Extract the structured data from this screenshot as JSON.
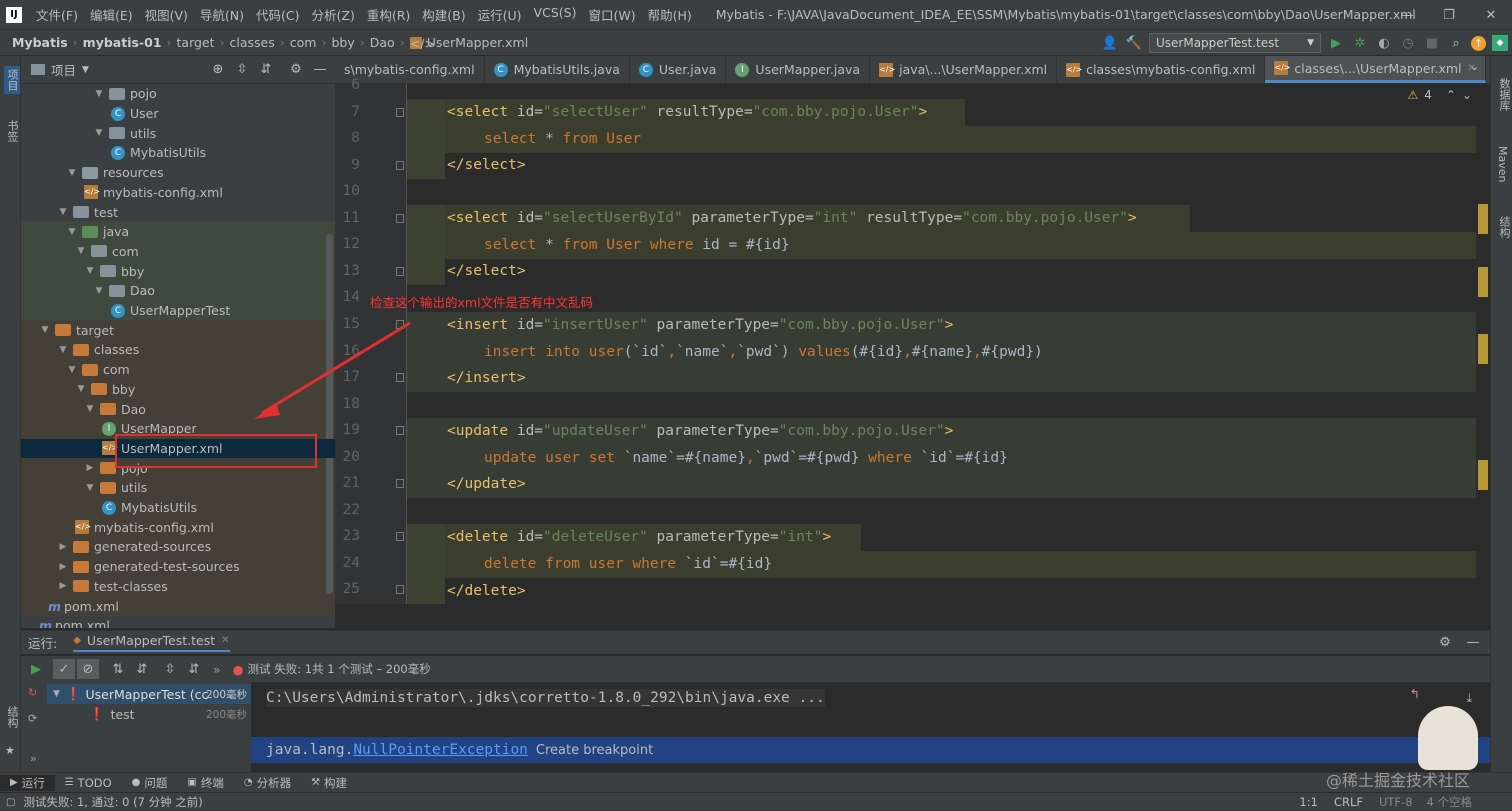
{
  "menu": [
    "文件(F)",
    "编辑(E)",
    "视图(V)",
    "导航(N)",
    "代码(C)",
    "分析(Z)",
    "重构(R)",
    "构建(B)",
    "运行(U)",
    "VCS(S)",
    "窗口(W)",
    "帮助(H)"
  ],
  "window_title": "Mybatis - F:\\JAVA\\JavaDocument_IDEA_EE\\SSM\\Mybatis\\mybatis-01\\target\\classes\\com\\bby\\Dao\\UserMapper.xml",
  "breadcrumb": [
    "Mybatis",
    "mybatis-01",
    "target",
    "classes",
    "com",
    "bby",
    "Dao",
    "UserMapper.xml"
  ],
  "run_config": "UserMapperTest.test",
  "left_stripe": {
    "project": "项目",
    "bookmarks": "书签",
    "structure": "结构"
  },
  "right_stripe": {
    "database": "数据库",
    "maven": "Maven",
    "structure": "结构"
  },
  "project_panel_title": "项目",
  "tree": [
    {
      "depth": 8,
      "kind": "folder",
      "expanded": true,
      "label": "pojo"
    },
    {
      "depth": 10,
      "kind": "class",
      "label": "User"
    },
    {
      "depth": 8,
      "kind": "folder",
      "expanded": true,
      "label": "utils"
    },
    {
      "depth": 10,
      "kind": "class",
      "label": "MybatisUtils"
    },
    {
      "depth": 5,
      "kind": "res",
      "expanded": true,
      "label": "resources"
    },
    {
      "depth": 7,
      "kind": "xml",
      "label": "mybatis-config.xml"
    },
    {
      "depth": 4,
      "kind": "folder",
      "expanded": true,
      "label": "test"
    },
    {
      "depth": 5,
      "kind": "src",
      "expanded": true,
      "label": "java"
    },
    {
      "depth": 6,
      "kind": "folder",
      "expanded": true,
      "label": "com"
    },
    {
      "depth": 7,
      "kind": "folder",
      "expanded": true,
      "label": "bby"
    },
    {
      "depth": 8,
      "kind": "folder",
      "expanded": true,
      "label": "Dao"
    },
    {
      "depth": 10,
      "kind": "class",
      "label": "UserMapperTest"
    },
    {
      "depth": 2,
      "kind": "ofolder",
      "expanded": true,
      "label": "target"
    },
    {
      "depth": 4,
      "kind": "ofolder",
      "expanded": true,
      "label": "classes"
    },
    {
      "depth": 5,
      "kind": "ofolder",
      "expanded": true,
      "label": "com"
    },
    {
      "depth": 6,
      "kind": "ofolder",
      "expanded": true,
      "label": "bby"
    },
    {
      "depth": 7,
      "kind": "ofolder",
      "expanded": true,
      "label": "Dao"
    },
    {
      "depth": 9,
      "kind": "intf",
      "label": "UserMapper"
    },
    {
      "depth": 9,
      "kind": "xml",
      "label": "UserMapper.xml",
      "selected": true
    },
    {
      "depth": 7,
      "kind": "ofolder",
      "expanded": false,
      "label": "pojo"
    },
    {
      "depth": 7,
      "kind": "ofolder",
      "expanded": true,
      "label": "utils"
    },
    {
      "depth": 9,
      "kind": "class",
      "label": "MybatisUtils"
    },
    {
      "depth": 6,
      "kind": "xml",
      "label": "mybatis-config.xml"
    },
    {
      "depth": 4,
      "kind": "ofolder",
      "expanded": false,
      "label": "generated-sources"
    },
    {
      "depth": 4,
      "kind": "ofolder",
      "expanded": false,
      "label": "generated-test-sources"
    },
    {
      "depth": 4,
      "kind": "ofolder",
      "expanded": false,
      "label": "test-classes"
    },
    {
      "depth": 3,
      "kind": "mvn",
      "label": "pom.xml"
    },
    {
      "depth": 2,
      "kind": "mvn",
      "label": "pom.xml"
    }
  ],
  "tabs": [
    {
      "label": "s\\mybatis-config.xml",
      "icon": "xml"
    },
    {
      "label": "MybatisUtils.java",
      "icon": "class"
    },
    {
      "label": "User.java",
      "icon": "class"
    },
    {
      "label": "UserMapper.java",
      "icon": "intf"
    },
    {
      "label": "java\\...\\UserMapper.xml",
      "icon": "xml"
    },
    {
      "label": "classes\\mybatis-config.xml",
      "icon": "xml"
    },
    {
      "label": "classes\\...\\UserMapper.xml",
      "icon": "xml",
      "active": true
    }
  ],
  "warnings_count": "4",
  "line_numbers": [
    "6",
    "7",
    "8",
    "9",
    "10",
    "11",
    "12",
    "13",
    "14",
    "15",
    "16",
    "17",
    "18",
    "19",
    "20",
    "21",
    "22",
    "23",
    "24",
    "25"
  ],
  "annotation": "检查这个输出的xml文件是否有中文乱码",
  "run": {
    "label": "运行:",
    "config_tab": "UserMapperTest.test",
    "result": "测试 失败: 1共 1 个测试 – 200毫秒",
    "tree": [
      {
        "label": "UserMapperTest (cc",
        "time": "200毫秒"
      },
      {
        "label": "test",
        "time": "200毫秒"
      }
    ],
    "console_line1": "C:\\Users\\Administrator\\.jdks\\corretto-1.8.0_292\\bin\\java.exe ...",
    "exception_pkg": "java.lang.",
    "exception_cls": "NullPointerException",
    "create_bp": "Create breakpoint"
  },
  "bottom_tabs": [
    "运行",
    "TODO",
    "问题",
    "终端",
    "分析器",
    "构建"
  ],
  "status": {
    "left": "测试失败: 1, 通过: 0 (7 分钟 之前)",
    "pos": "1:1",
    "eol": "CRLF",
    "enc": "UTF-8",
    "indent": "4 个空格"
  },
  "watermark": "@稀土掘金技术社区"
}
